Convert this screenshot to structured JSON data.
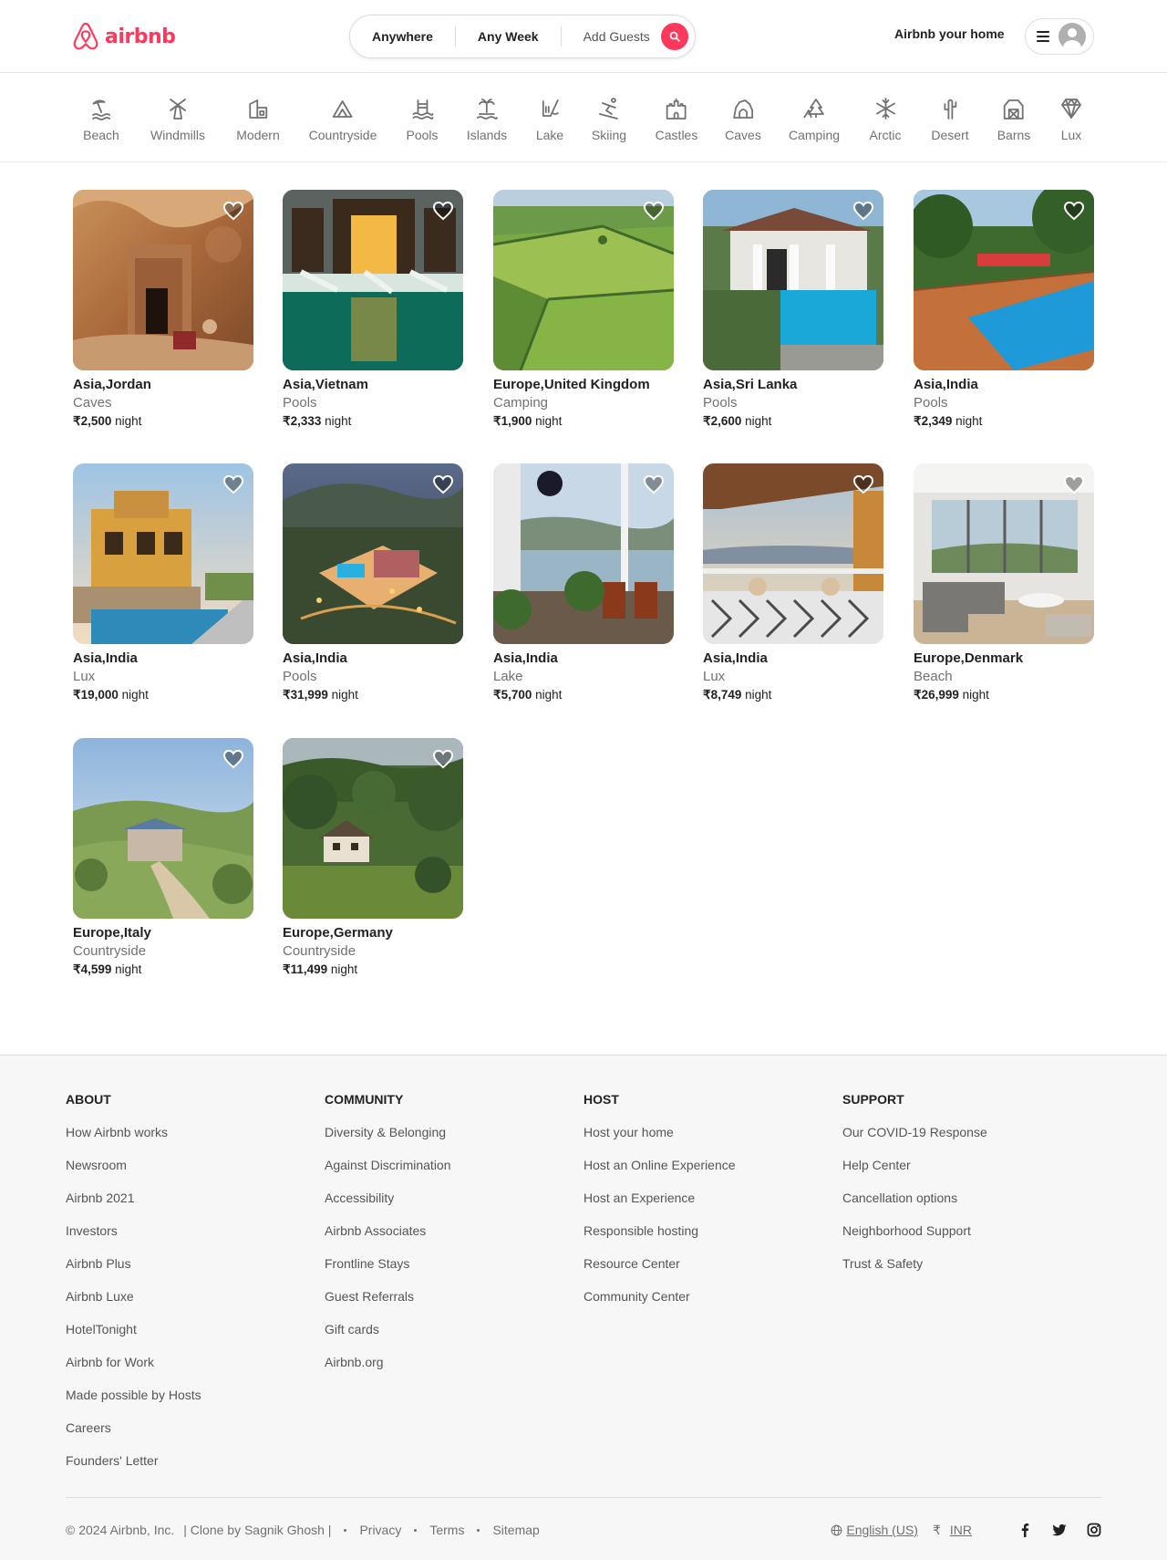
{
  "header": {
    "logo_text": "airbnb",
    "search": {
      "anywhere": "Anywhere",
      "any_week": "Any Week",
      "add_guests": "Add Guests"
    },
    "host_link": "Airbnb your home",
    "brand_color": "#FF385C"
  },
  "categories": [
    {
      "label": "Beach",
      "icon": "beach-icon"
    },
    {
      "label": "Windmills",
      "icon": "windmill-icon"
    },
    {
      "label": "Modern",
      "icon": "modern-house-icon"
    },
    {
      "label": "Countryside",
      "icon": "countryside-icon"
    },
    {
      "label": "Pools",
      "icon": "pool-icon"
    },
    {
      "label": "Islands",
      "icon": "island-icon"
    },
    {
      "label": "Lake",
      "icon": "lake-icon"
    },
    {
      "label": "Skiing",
      "icon": "skiing-icon"
    },
    {
      "label": "Castles",
      "icon": "castle-icon"
    },
    {
      "label": "Caves",
      "icon": "cave-icon"
    },
    {
      "label": "Camping",
      "icon": "camping-icon"
    },
    {
      "label": "Arctic",
      "icon": "snowflake-icon"
    },
    {
      "label": "Desert",
      "icon": "cactus-icon"
    },
    {
      "label": "Barns",
      "icon": "barn-icon"
    },
    {
      "label": "Lux",
      "icon": "diamond-icon"
    }
  ],
  "listings": [
    {
      "location": "Asia,Jordan",
      "category": "Caves",
      "price": "₹2,500",
      "unit": "night",
      "scene": "cave"
    },
    {
      "location": "Asia,Vietnam",
      "category": "Pools",
      "price": "₹2,333",
      "unit": "night",
      "scene": "pool-night"
    },
    {
      "location": "Europe,United Kingdom",
      "category": "Camping",
      "price": "₹1,900",
      "unit": "night",
      "scene": "fields"
    },
    {
      "location": "Asia,Sri Lanka",
      "category": "Pools",
      "price": "₹2,600",
      "unit": "night",
      "scene": "villa-pool"
    },
    {
      "location": "Asia,India",
      "category": "Pools",
      "price": "₹2,349",
      "unit": "night",
      "scene": "garden-pool"
    },
    {
      "location": "Asia,India",
      "category": "Lux",
      "price": "₹19,000",
      "unit": "night",
      "scene": "lux-villa"
    },
    {
      "location": "Asia,India",
      "category": "Pools",
      "price": "₹31,999",
      "unit": "night",
      "scene": "aerial-villa"
    },
    {
      "location": "Asia,India",
      "category": "Lake",
      "price": "₹5,700",
      "unit": "night",
      "scene": "lake-balcony"
    },
    {
      "location": "Asia,India",
      "category": "Lux",
      "price": "₹8,749",
      "unit": "night",
      "scene": "terrace"
    },
    {
      "location": "Europe,Denmark",
      "category": "Beach",
      "price": "₹26,999",
      "unit": "night",
      "scene": "living-room"
    },
    {
      "location": "Europe,Italy",
      "category": "Countryside",
      "price": "₹4,599",
      "unit": "night",
      "scene": "hill-house"
    },
    {
      "location": "Europe,Germany",
      "category": "Countryside",
      "price": "₹11,499",
      "unit": "night",
      "scene": "forest-house"
    }
  ],
  "footer": {
    "columns": [
      {
        "title": "ABOUT",
        "links": [
          "How Airbnb works",
          "Newsroom",
          "Airbnb 2021",
          "Investors",
          "Airbnb Plus",
          "Airbnb Luxe",
          "HotelTonight",
          "Airbnb for Work",
          "Made possible by Hosts",
          "Careers",
          "Founders' Letter"
        ]
      },
      {
        "title": "COMMUNITY",
        "links": [
          "Diversity & Belonging",
          "Against Discrimination",
          "Accessibility",
          "Airbnb Associates",
          "Frontline Stays",
          "Guest Referrals",
          "Gift cards",
          "Airbnb.org"
        ]
      },
      {
        "title": "HOST",
        "links": [
          "Host your home",
          "Host an Online Experience",
          "Host an Experience",
          "Responsible hosting",
          "Resource Center",
          "Community Center"
        ]
      },
      {
        "title": "SUPPORT",
        "links": [
          "Our COVID-19 Response",
          "Help Center",
          "Cancellation options",
          "Neighborhood Support",
          "Trust & Safety"
        ]
      }
    ],
    "copyright": "© 2024 Airbnb, Inc.",
    "credit": "| Clone by Sagnik Ghosh |",
    "legal": [
      "Privacy",
      "Terms",
      "Sitemap"
    ],
    "language": "English (US)",
    "currency_symbol": "₹",
    "currency_code": "INR",
    "social": [
      "facebook-icon",
      "twitter-icon",
      "instagram-icon"
    ]
  }
}
